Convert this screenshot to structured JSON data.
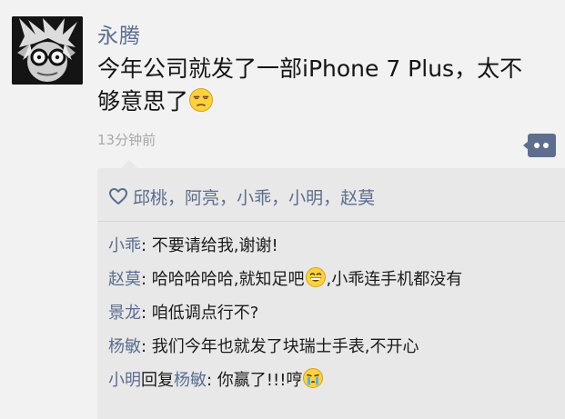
{
  "post": {
    "username": "永腾",
    "content_text": "今年公司就发了一部iPhone 7 Plus，太不够意思了",
    "content_emoji": "unamused-face-emoji",
    "timestamp": "13分钟前"
  },
  "likes": {
    "icon": "heart-outline-icon",
    "separator": "，",
    "names": [
      "邱桃",
      "阿亮",
      "小乖",
      "小明",
      "赵莫"
    ]
  },
  "comments": [
    {
      "author": "小乖",
      "colon": ": ",
      "text": "不要请给我,谢谢!"
    },
    {
      "author": "赵莫",
      "colon": ": ",
      "text": "哈哈哈哈哈,就知足吧",
      "emoji": "grinning-face-emoji",
      "text_after": ",小乖连手机都没有"
    },
    {
      "author": "景龙",
      "colon": ": ",
      "text": "咱低调点行不?"
    },
    {
      "author": "杨敏",
      "colon": ": ",
      "text": "我们今年也就发了块瑞士手表,不开心"
    },
    {
      "author": "小明",
      "reply_word": "回复",
      "reply_to": "杨敏",
      "colon": ": ",
      "text": "你赢了!!!哼",
      "emoji": "crying-face-emoji"
    }
  ],
  "colors": {
    "name_blue": "#5b6d8f",
    "background": "#f2f2f2",
    "comment_bg": "#e8e8e8",
    "timestamp_gray": "#a8a8a8"
  }
}
